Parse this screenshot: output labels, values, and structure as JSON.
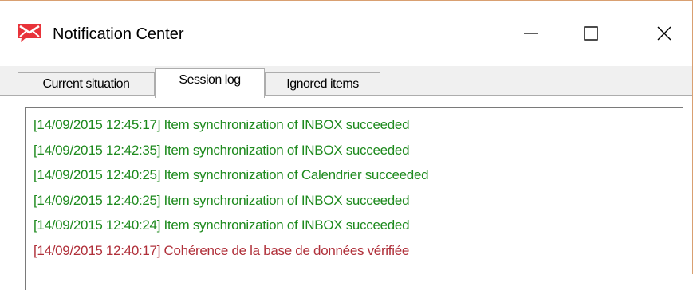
{
  "window": {
    "title": "Notification Center",
    "icon": "envelope-app-icon",
    "controls": {
      "minimize_icon": "minimize-icon",
      "maximize_icon": "maximize-icon",
      "close_icon": "close-icon"
    }
  },
  "tabs": [
    {
      "label": "Current situation",
      "active": false
    },
    {
      "label": "Session log",
      "active": true
    },
    {
      "label": "Ignored items",
      "active": false
    }
  ],
  "log": {
    "entries": [
      {
        "text": "[14/09/2015 12:45:17] Item synchronization of INBOX succeeded",
        "level": "success"
      },
      {
        "text": "[14/09/2015 12:42:35] Item synchronization of INBOX succeeded",
        "level": "success"
      },
      {
        "text": "[14/09/2015 12:40:25] Item synchronization of Calendrier succeeded",
        "level": "success"
      },
      {
        "text": "[14/09/2015 12:40:25] Item synchronization of INBOX succeeded",
        "level": "success"
      },
      {
        "text": "[14/09/2015 12:40:24] Item synchronization of INBOX succeeded",
        "level": "success"
      },
      {
        "text": "[14/09/2015 12:40:17] Cohérence de la base de données vérifiée",
        "level": "warning"
      }
    ]
  },
  "colors": {
    "success": "#1e8a1e",
    "warning": "#b0303a",
    "icon_red": "#e8333a"
  }
}
